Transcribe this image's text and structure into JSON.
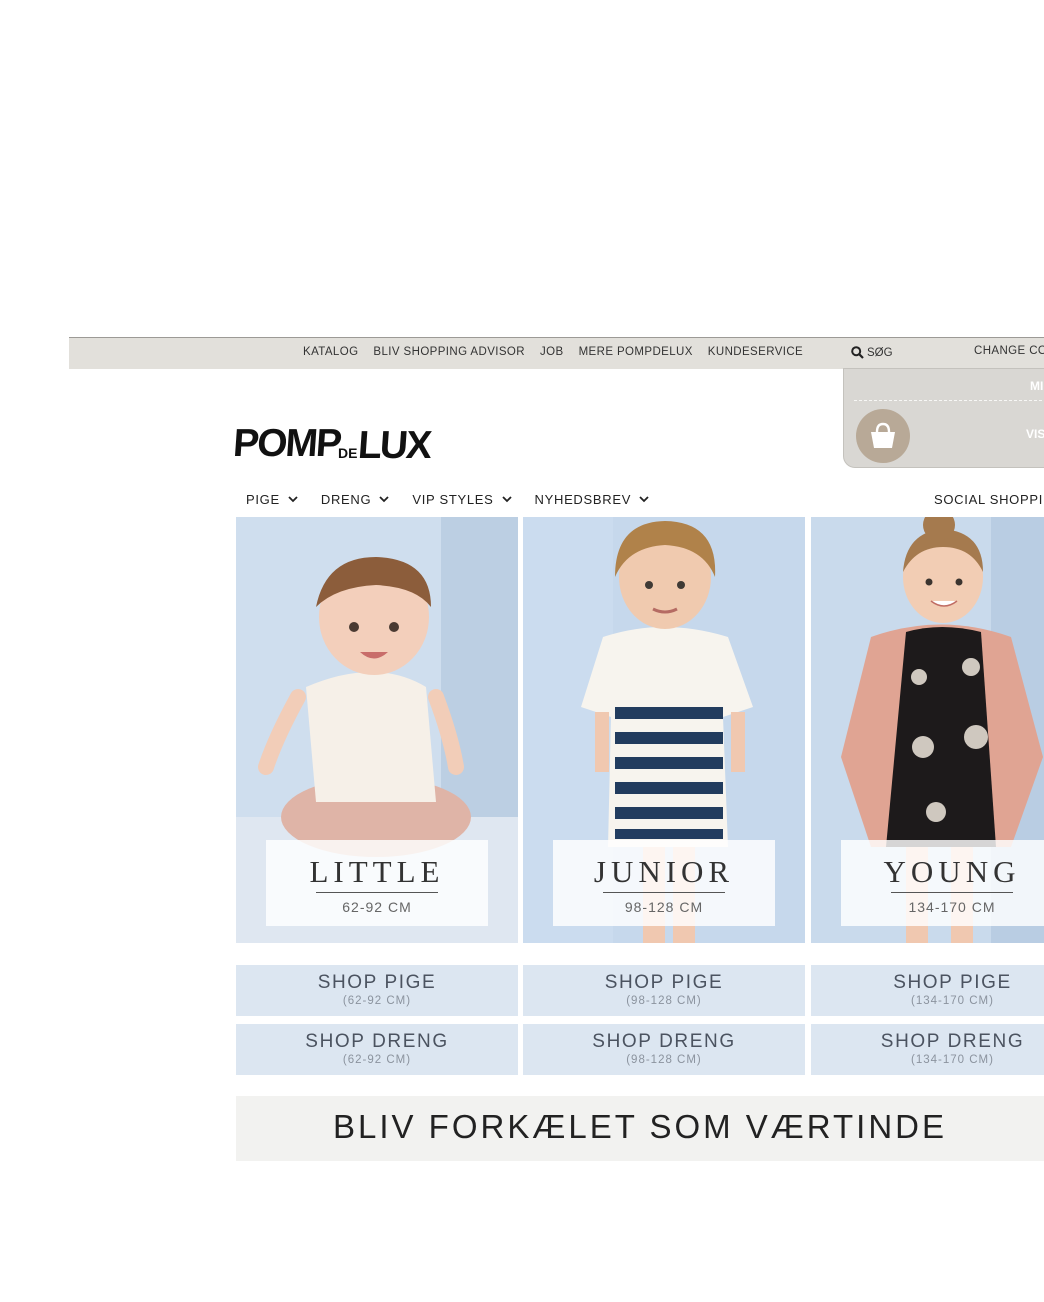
{
  "topbar": {
    "links": [
      "KATALOG",
      "BLIV SHOPPING ADVISOR",
      "JOB",
      "MERE POMPDELUX",
      "KUNDESERVICE"
    ],
    "search_label": "SØG",
    "change_label": "CHANGE CO"
  },
  "cart": {
    "line1": "MI",
    "line2": "VIS",
    "icon": "shopping-bag-icon"
  },
  "logo": {
    "text_pomp": "POMP",
    "text_de": "DE",
    "text_lux": "LUX"
  },
  "mainnav": {
    "items": [
      "PIGE",
      "DRENG",
      "VIP STYLES",
      "NYHEDSBREV"
    ],
    "social": "SOCIAL SHOPPIN"
  },
  "tiles": [
    {
      "title": "LITTLE",
      "range": "62-92 CM"
    },
    {
      "title": "JUNIOR",
      "range": "98-128 CM"
    },
    {
      "title": "YOUNG",
      "range": "134-170 CM"
    }
  ],
  "shop_pige": [
    {
      "label": "SHOP PIGE",
      "range": "(62-92 CM)"
    },
    {
      "label": "SHOP PIGE",
      "range": "(98-128 CM)"
    },
    {
      "label": "SHOP PIGE",
      "range": "(134-170 CM)"
    }
  ],
  "shop_dreng": [
    {
      "label": "SHOP DRENG",
      "range": "(62-92 CM)"
    },
    {
      "label": "SHOP DRENG",
      "range": "(98-128 CM)"
    },
    {
      "label": "SHOP DRENG",
      "range": "(134-170 CM)"
    }
  ],
  "banner": {
    "text": "BLIV FORKÆLET SOM VÆRTINDE"
  },
  "colors": {
    "topbar_bg": "#e2e0db",
    "tile_bg": "#c9daec",
    "shop_button_bg": "#dce6f1",
    "cart_bag": "#b8a997",
    "banner_bg": "#f2f2f0"
  }
}
